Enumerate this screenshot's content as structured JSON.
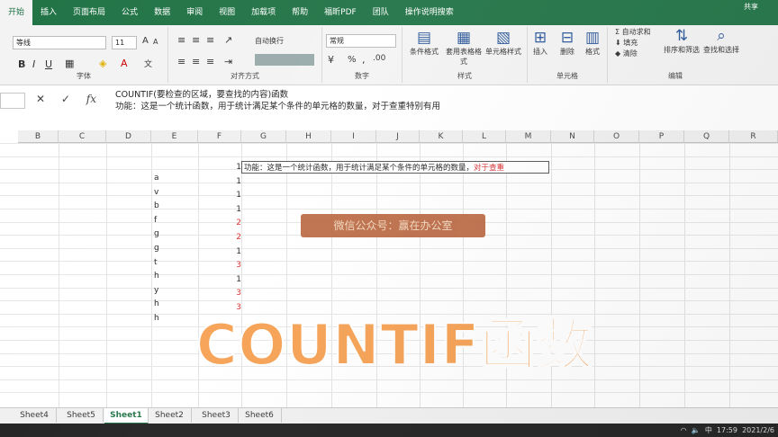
{
  "tabs": [
    "开始",
    "插入",
    "页面布局",
    "公式",
    "数据",
    "审阅",
    "视图",
    "加载项",
    "帮助",
    "福昕PDF",
    "团队",
    "操作说明搜索"
  ],
  "account_label": "共享",
  "ribbon": {
    "font_name": "等线",
    "font_size": "11",
    "font_group_label": "字体",
    "align_group_label": "对齐方式",
    "wrap_label": "自动换行",
    "number_format": "常规",
    "number_group_label": "数字",
    "percent_symbol": "%",
    "conditional_format_label": "条件格式",
    "table_format_label": "套用表格格式",
    "cell_style_label": "单元格样式",
    "styles_group_label": "样式",
    "insert_label": "插入",
    "delete_label": "删除",
    "format_label": "格式",
    "cells_group_label": "单元格",
    "autosum_label": "自动求和",
    "fill_label": "填充",
    "clear_label": "清除",
    "sort_filter_label": "排序和筛选",
    "find_select_label": "查找和选择",
    "editing_group_label": "编辑"
  },
  "formula_bar": {
    "line1": "COUNTIF(要检查的区域，要查找的内容)函数",
    "line2": "功能：这是一个统计函数，用于统计满足某个条件的单元格的数量，对于查重特别有用"
  },
  "grid": {
    "columns": [
      "B",
      "C",
      "D",
      "E",
      "F",
      "G",
      "H",
      "I",
      "J",
      "K",
      "L",
      "M",
      "N",
      "O",
      "P",
      "Q",
      "R"
    ],
    "letters": [
      "a",
      "v",
      "b",
      "f",
      "g",
      "g",
      "t",
      "h",
      "y",
      "h",
      "h"
    ],
    "counts": [
      1,
      1,
      1,
      1,
      2,
      2,
      1,
      3,
      1,
      3,
      3
    ],
    "note_main": "功能：这是一个统计函数，用于统计满足某个条件的单元格的数量，",
    "note_highlight": "对于查重",
    "watermark": "微信公众号：赢在办公室"
  },
  "overlay_title": "COUNTIF函数",
  "sheets": [
    "Sheet4",
    "Sheet5",
    "Sheet1",
    "Sheet2",
    "Sheet3",
    "Sheet6"
  ],
  "active_sheet": "Sheet1",
  "tray": {
    "lang": "中",
    "time": "17:59",
    "date": "2021/2/6"
  },
  "colors": {
    "excel_green": "#217346",
    "count_red": "#d92b2b",
    "title_orange": "#f6a052",
    "watermark_bg": "#b8623b"
  }
}
